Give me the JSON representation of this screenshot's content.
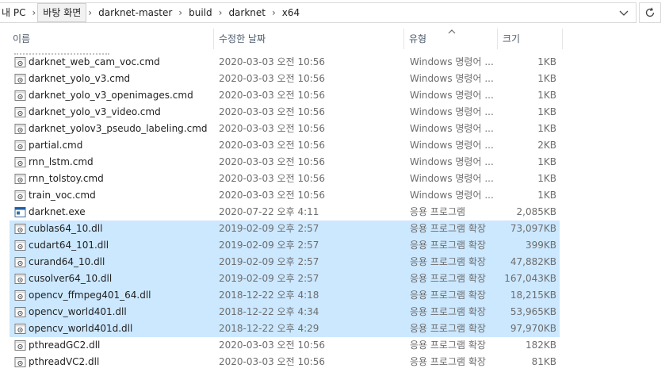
{
  "breadcrumb": {
    "items": [
      "내 PC",
      "바탕 화면",
      "darknet-master",
      "build",
      "darknet",
      "x64"
    ],
    "separator": "›",
    "active_index": 1
  },
  "columns": {
    "name": "이름",
    "date": "수정한 날짜",
    "type": "유형",
    "size": "크기"
  },
  "colors": {
    "selection": "#cce8ff",
    "header_text": "#4c5a6b",
    "exe_icon": "#1f5fa8"
  },
  "files": [
    {
      "name": "darknet_web_cam_voc.cmd",
      "date": "2020-03-03 오전 10:56",
      "type": "Windows 명령어 ...",
      "size": "1KB",
      "icon": "cmd-file-icon",
      "selected": false
    },
    {
      "name": "darknet_yolo_v3.cmd",
      "date": "2020-03-03 오전 10:56",
      "type": "Windows 명령어 ...",
      "size": "1KB",
      "icon": "cmd-file-icon",
      "selected": false
    },
    {
      "name": "darknet_yolo_v3_openimages.cmd",
      "date": "2020-03-03 오전 10:56",
      "type": "Windows 명령어 ...",
      "size": "1KB",
      "icon": "cmd-file-icon",
      "selected": false
    },
    {
      "name": "darknet_yolo_v3_video.cmd",
      "date": "2020-03-03 오전 10:56",
      "type": "Windows 명령어 ...",
      "size": "1KB",
      "icon": "cmd-file-icon",
      "selected": false
    },
    {
      "name": "darknet_yolov3_pseudo_labeling.cmd",
      "date": "2020-03-03 오전 10:56",
      "type": "Windows 명령어 ...",
      "size": "1KB",
      "icon": "cmd-file-icon",
      "selected": false
    },
    {
      "name": "partial.cmd",
      "date": "2020-03-03 오전 10:56",
      "type": "Windows 명령어 ...",
      "size": "2KB",
      "icon": "cmd-file-icon",
      "selected": false
    },
    {
      "name": "rnn_lstm.cmd",
      "date": "2020-03-03 오전 10:56",
      "type": "Windows 명령어 ...",
      "size": "1KB",
      "icon": "cmd-file-icon",
      "selected": false
    },
    {
      "name": "rnn_tolstoy.cmd",
      "date": "2020-03-03 오전 10:56",
      "type": "Windows 명령어 ...",
      "size": "1KB",
      "icon": "cmd-file-icon",
      "selected": false
    },
    {
      "name": "train_voc.cmd",
      "date": "2020-03-03 오전 10:56",
      "type": "Windows 명령어 ...",
      "size": "1KB",
      "icon": "cmd-file-icon",
      "selected": false
    },
    {
      "name": "darknet.exe",
      "date": "2020-07-22 오후 4:11",
      "type": "응용 프로그램",
      "size": "2,085KB",
      "icon": "exe-file-icon",
      "selected": false
    },
    {
      "name": "cublas64_10.dll",
      "date": "2019-02-09 오후 2:57",
      "type": "응용 프로그램 확장",
      "size": "73,097KB",
      "icon": "dll-file-icon",
      "selected": true
    },
    {
      "name": "cudart64_101.dll",
      "date": "2019-02-09 오후 2:57",
      "type": "응용 프로그램 확장",
      "size": "399KB",
      "icon": "dll-file-icon",
      "selected": true
    },
    {
      "name": "curand64_10.dll",
      "date": "2019-02-09 오후 2:57",
      "type": "응용 프로그램 확장",
      "size": "47,882KB",
      "icon": "dll-file-icon",
      "selected": true
    },
    {
      "name": "cusolver64_10.dll",
      "date": "2019-02-09 오후 2:57",
      "type": "응용 프로그램 확장",
      "size": "167,043KB",
      "icon": "dll-file-icon",
      "selected": true
    },
    {
      "name": "opencv_ffmpeg401_64.dll",
      "date": "2018-12-22 오후 4:18",
      "type": "응용 프로그램 확장",
      "size": "18,215KB",
      "icon": "dll-file-icon",
      "selected": true
    },
    {
      "name": "opencv_world401.dll",
      "date": "2018-12-22 오후 4:34",
      "type": "응용 프로그램 확장",
      "size": "53,965KB",
      "icon": "dll-file-icon",
      "selected": true
    },
    {
      "name": "opencv_world401d.dll",
      "date": "2018-12-22 오후 4:29",
      "type": "응용 프로그램 확장",
      "size": "97,970KB",
      "icon": "dll-file-icon",
      "selected": true
    },
    {
      "name": "pthreadGC2.dll",
      "date": "2020-03-03 오전 10:56",
      "type": "응용 프로그램 확장",
      "size": "182KB",
      "icon": "dll-file-icon",
      "selected": false
    },
    {
      "name": "pthreadVC2.dll",
      "date": "2020-03-03 오전 10:56",
      "type": "응용 프로그램 확장",
      "size": "81KB",
      "icon": "dll-file-icon",
      "selected": false
    }
  ]
}
